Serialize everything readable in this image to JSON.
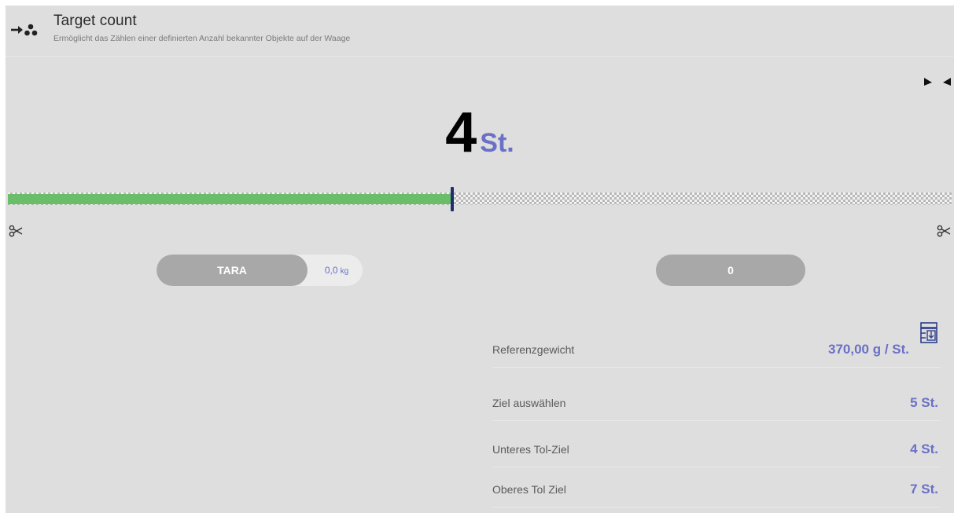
{
  "header": {
    "title": "Target count",
    "subtitle": "Ermöglicht das Zählen einer definierten Anzahl bekannter Objekte auf der Waage",
    "icon": "arrow-to-objects-icon"
  },
  "count": {
    "value": "4",
    "unit": "St."
  },
  "progress": {
    "fraction": 0.47
  },
  "tare": {
    "button_label": "TARA",
    "value": "0,0",
    "unit": "kg"
  },
  "zero_button": {
    "label": "0"
  },
  "info_rows": [
    {
      "label": "Referenzgewicht",
      "value": "370,00  g / St."
    },
    {
      "label": "Ziel auswählen",
      "value": "5 St."
    },
    {
      "label": "Unteres Tol-Ziel",
      "value": "4 St."
    },
    {
      "label": "Oberes Tol Ziel",
      "value": "7 St."
    }
  ],
  "colors": {
    "accent": "#6a70c6",
    "progress_fill": "#6abe6a",
    "marker": "#1e2f6b",
    "button": "#a8a8a8",
    "background": "#dedede"
  }
}
